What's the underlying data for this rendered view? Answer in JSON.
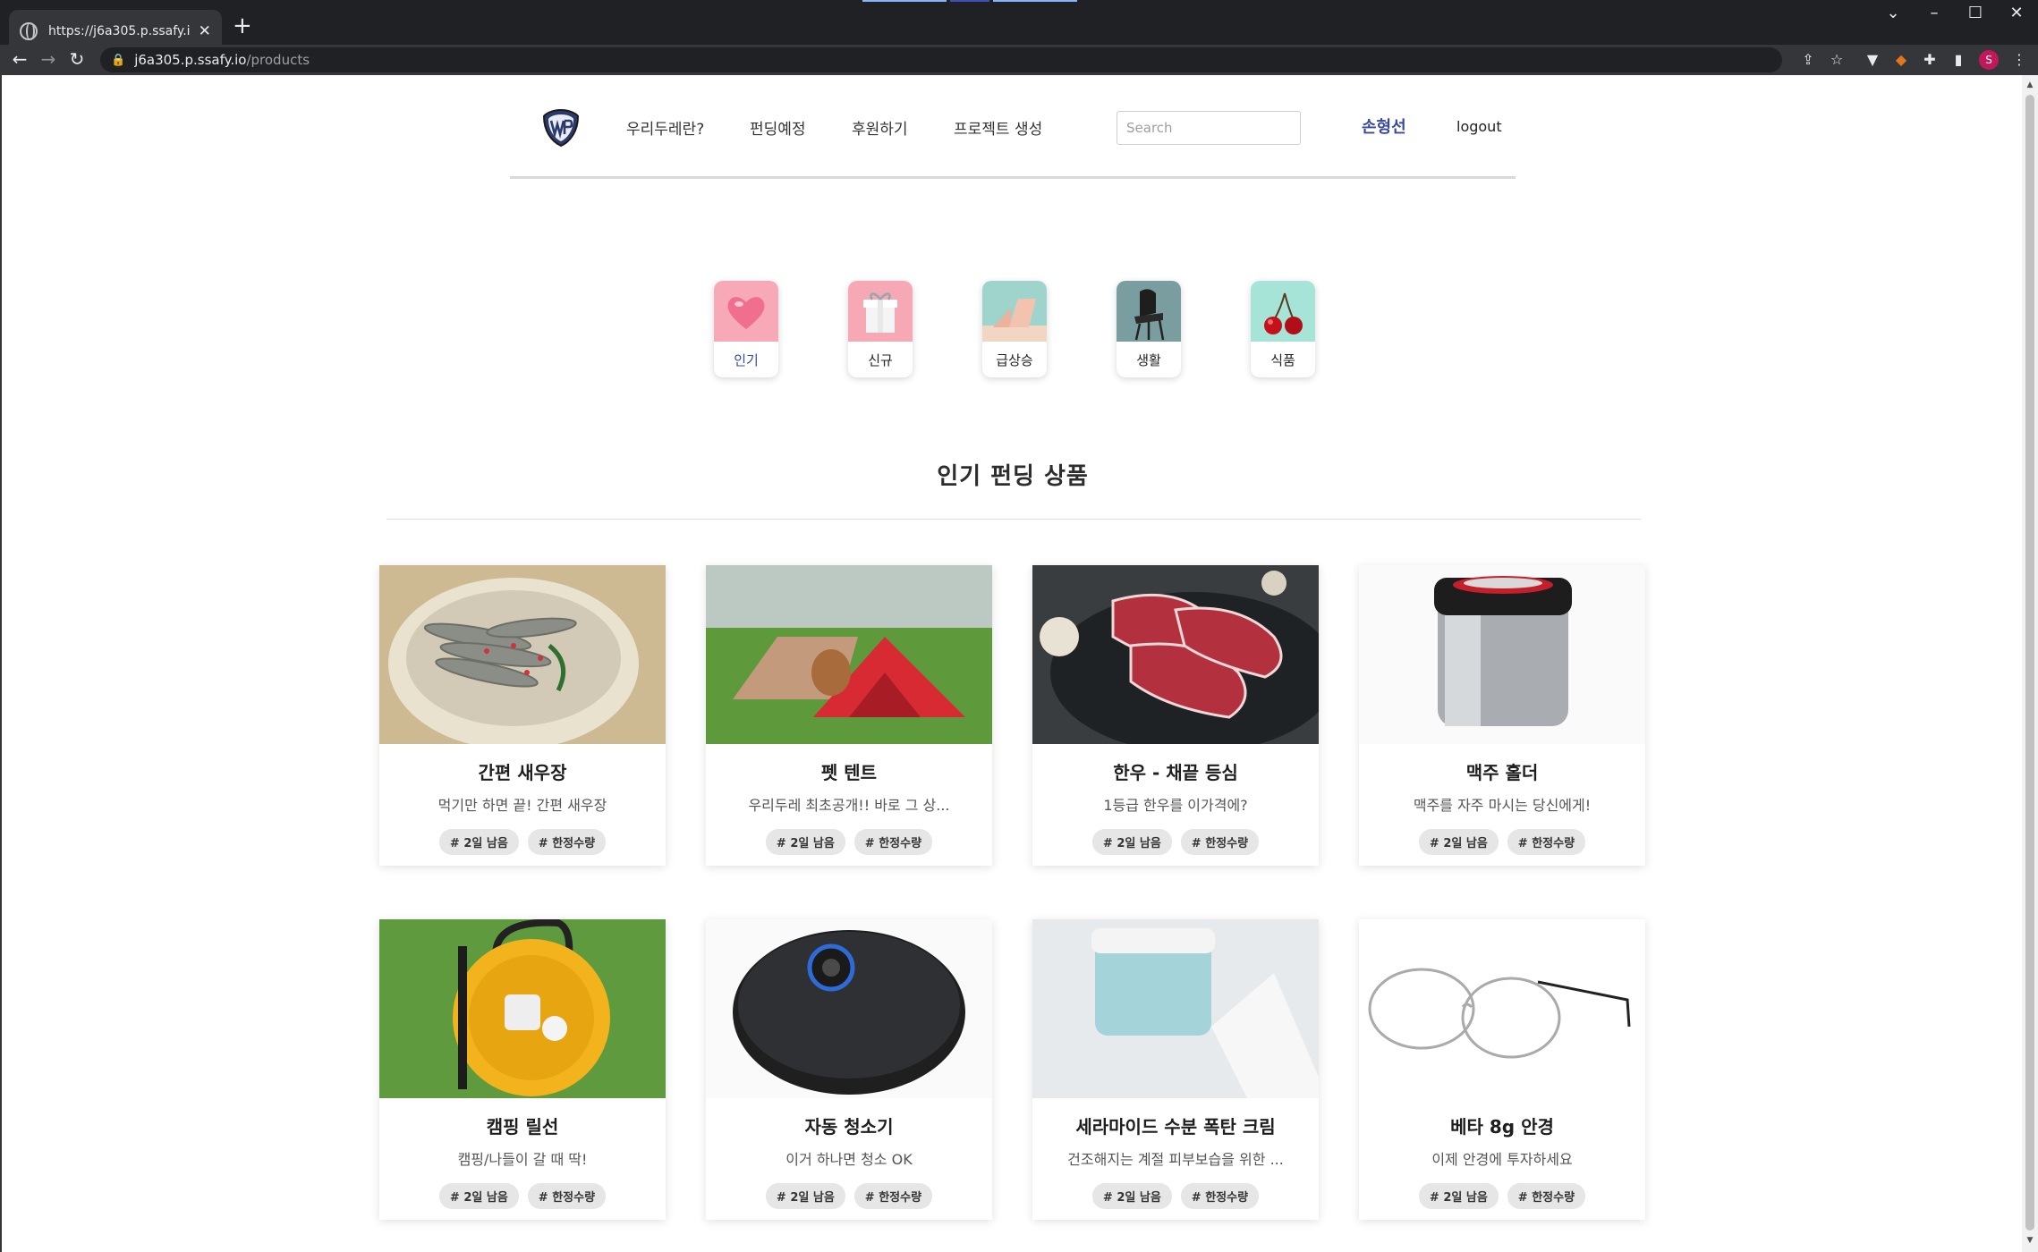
{
  "browser": {
    "tab_title": "https://j6a305.p.ssafy.io/products",
    "tab_close": "✕",
    "new_tab": "+",
    "url_host": "j6a305.p.ssafy.io",
    "url_path": "/products",
    "profile_initial": "S"
  },
  "header": {
    "nav": [
      "우리두레란?",
      "펀딩예정",
      "후원하기",
      "프로젝트 생성"
    ],
    "search_placeholder": "Search",
    "user_name": "손형선",
    "logout": "logout"
  },
  "categories": [
    {
      "label": "인기",
      "active": true
    },
    {
      "label": "신규",
      "active": false
    },
    {
      "label": "급상승",
      "active": false
    },
    {
      "label": "생활",
      "active": false
    },
    {
      "label": "식품",
      "active": false
    }
  ],
  "section_title": "인기 펀딩 상품",
  "products": [
    {
      "title": "간편 새우장",
      "desc": "먹기만 하면 끝! 간편 새우장",
      "tags": [
        "# 2일 남음",
        "# 한정수량"
      ]
    },
    {
      "title": "펫 텐트",
      "desc": "우리두레 최초공개!! 바로 그 상...",
      "tags": [
        "# 2일 남음",
        "# 한정수량"
      ]
    },
    {
      "title": "한우 - 채끝 등심",
      "desc": "1등급 한우를 이가격에?",
      "tags": [
        "# 2일 남음",
        "# 한정수량"
      ]
    },
    {
      "title": "맥주 홀더",
      "desc": "맥주를 자주 마시는 당신에게!",
      "tags": [
        "# 2일 남음",
        "# 한정수량"
      ]
    },
    {
      "title": "캠핑 릴선",
      "desc": "캠핑/나들이 갈 때 딱!",
      "tags": [
        "# 2일 남음",
        "# 한정수량"
      ]
    },
    {
      "title": "자동 청소기",
      "desc": "이거 하나면 청소 OK",
      "tags": [
        "# 2일 남음",
        "# 한정수량"
      ]
    },
    {
      "title": "세라마이드 수분 폭탄 크림",
      "desc": "건조해지는 계절 피부보습을 위한 ...",
      "tags": [
        "# 2일 남음",
        "# 한정수량"
      ]
    },
    {
      "title": "베타 8g 안경",
      "desc": "이제 안경에 투자하세요",
      "tags": [
        "# 2일 남음",
        "# 한정수량"
      ]
    }
  ],
  "colors": {
    "accent": "#3a4a9a",
    "tag_bg": "#e6e6e6",
    "chrome_dark": "#202124"
  }
}
